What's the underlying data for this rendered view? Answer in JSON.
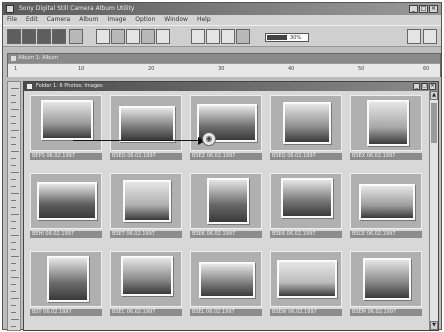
{
  "window": {
    "title": "Sony Digital Still Camera Album Utility"
  },
  "menu": [
    "File",
    "Edit",
    "Camera",
    "Album",
    "Image",
    "Option",
    "Window",
    "Help"
  ],
  "toolbar": {
    "zoom_value": "30%"
  },
  "back_window": {
    "title": "Album 1: Album",
    "ruler_marks": [
      "1",
      "10",
      "20",
      "30",
      "40",
      "50",
      "60"
    ]
  },
  "front_window": {
    "title": "Folder 1: 6 Photos: Images"
  },
  "thumbnails": [
    {
      "label": "BEPS 06.02.1997",
      "icon": "beach-water-photo",
      "tone": "#9a9a9a"
    },
    {
      "label": "BSEO 06.02.1997",
      "icon": "sunset-clouds-photo",
      "tone": "#7a7a7a"
    },
    {
      "label": "BSEZ 06.02.1997",
      "icon": "palm-beach-photo",
      "tone": "#6e6e6e"
    },
    {
      "label": "BSEQ 06.02.1997",
      "icon": "ocean-horizon-photo",
      "tone": "#8e8e8e"
    },
    {
      "label": "BSEX 06.02.1997",
      "icon": "sailboat-photo",
      "tone": "#a8a8a8"
    },
    {
      "label": "BEHI 06.02.1997",
      "icon": "palm-sunset-photo",
      "tone": "#5e5e5e"
    },
    {
      "label": "BSET 06.02.1997",
      "icon": "portrait-beach-photo",
      "tone": "#b0b0b0"
    },
    {
      "label": "BSEK 06.02.1997",
      "icon": "palm-trees-photo",
      "tone": "#666666"
    },
    {
      "label": "BSEA 06.02.1997",
      "icon": "boat-water-photo",
      "tone": "#747474"
    },
    {
      "label": "BSCE 06.02.1997",
      "icon": "calm-sea-photo",
      "tone": "#9e9e9e"
    },
    {
      "label": "BST 06.02.1997",
      "icon": "palm-shadow-photo",
      "tone": "#6a6a6a"
    },
    {
      "label": "BSEC 06.02.1997",
      "icon": "shoreline-photo",
      "tone": "#8a8a8a"
    },
    {
      "label": "BSEL 06.02.1997",
      "icon": "bay-view-photo",
      "tone": "#7c7c7c"
    },
    {
      "label": "BSEW 06.02.1997",
      "icon": "bright-sun-photo",
      "tone": "#bcbcbc"
    },
    {
      "label": "BSEM 06.02.1997",
      "icon": "island-photo",
      "tone": "#868686"
    }
  ],
  "pointer_icon": "camera-icon"
}
